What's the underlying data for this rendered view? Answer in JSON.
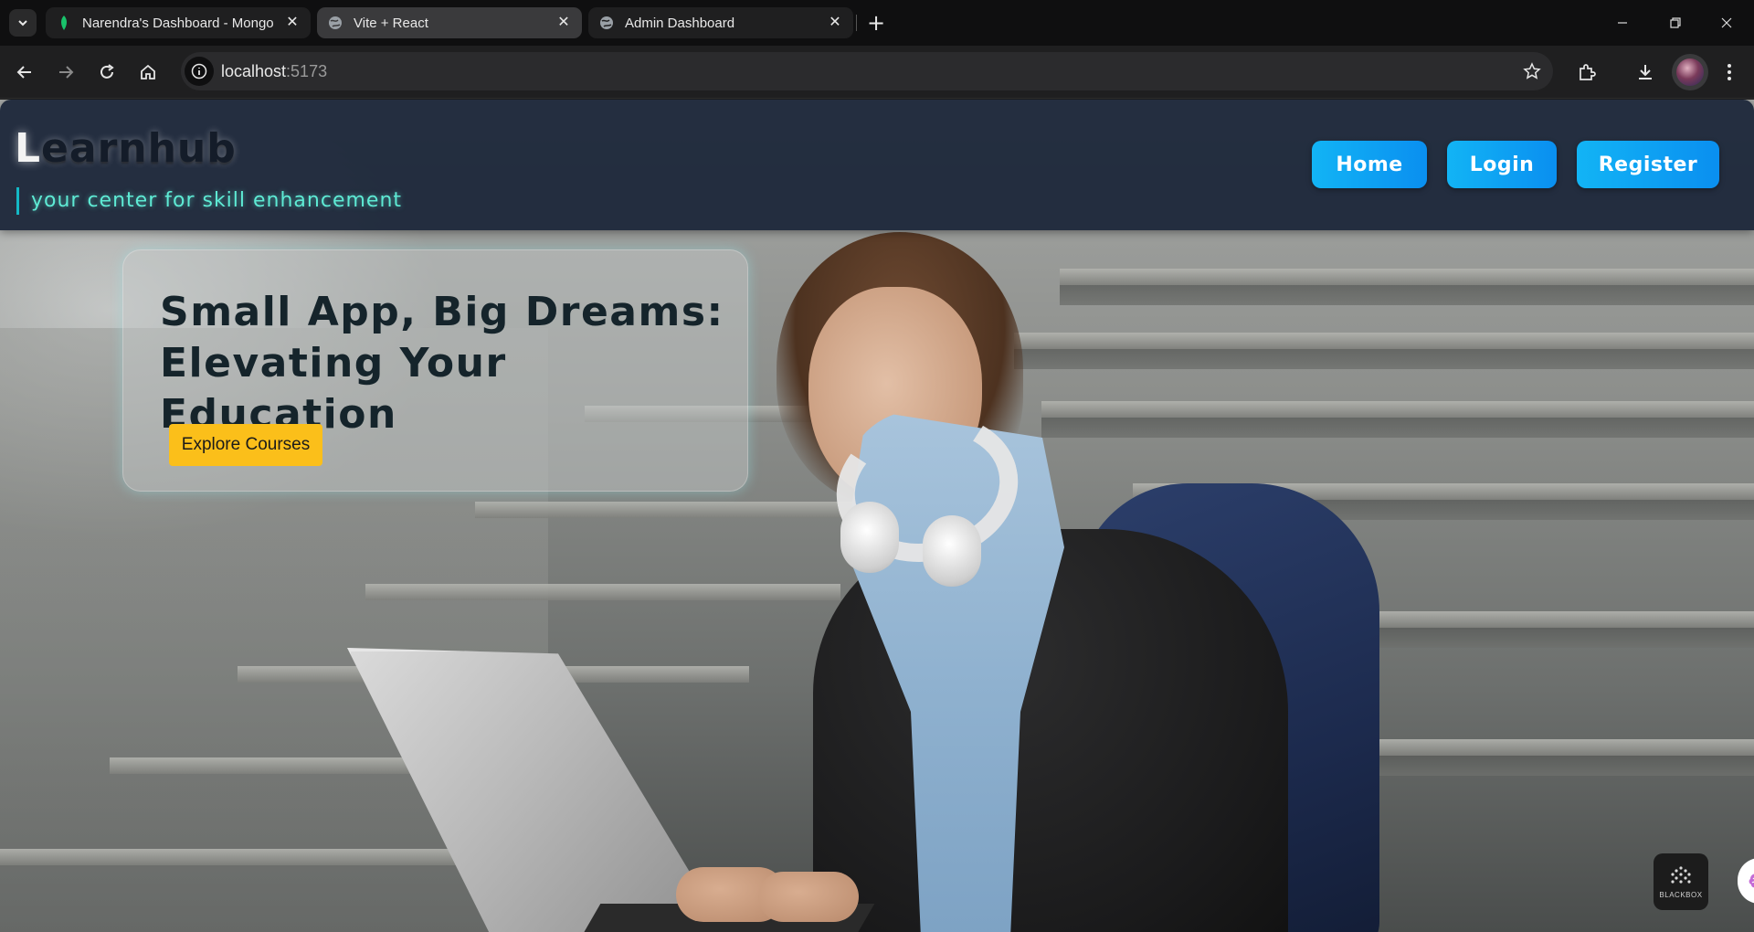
{
  "browser": {
    "tabs": [
      {
        "title": "Narendra's Dashboard - Mongo",
        "icon": "mongodb-leaf-icon",
        "active": false
      },
      {
        "title": "Vite + React",
        "icon": "globe-icon",
        "active": true
      },
      {
        "title": "Admin Dashboard",
        "icon": "globe-icon",
        "active": false
      }
    ],
    "new_tab_label": "+",
    "url_host": "localhost",
    "url_port": ":5173"
  },
  "site": {
    "logo_first": "L",
    "logo_rest": "earnhub",
    "tagline": "your center for skill enhancement",
    "nav": {
      "home": "Home",
      "login": "Login",
      "register": "Register"
    },
    "colors": {
      "header_bg": "#1e293b",
      "nav_button": "#0a9ff2",
      "tagline": "#5eead4",
      "cta": "#fbbf1a"
    }
  },
  "hero": {
    "title_line1": "Small App, Big Dreams:",
    "title_line2": "Elevating Your Education",
    "cta_label": "Explore Courses"
  },
  "widgets": {
    "blackbox_label": "BLACKBOX"
  }
}
